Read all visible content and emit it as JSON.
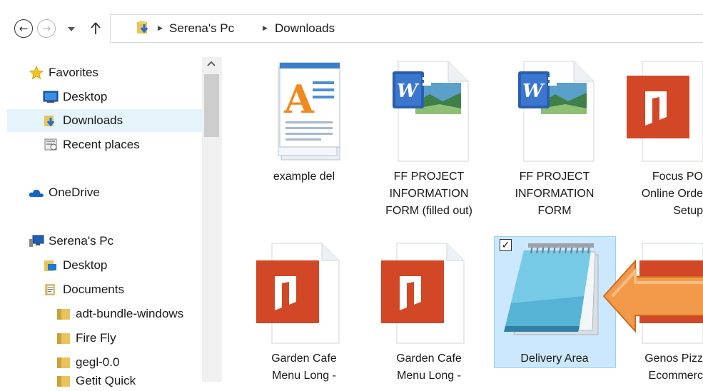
{
  "address_bar": {
    "crumbs": [
      "Serena's Pc",
      "Downloads"
    ]
  },
  "nav": {
    "favorites_label": "Favorites",
    "favorites": [
      "Desktop",
      "Downloads",
      "Recent places"
    ],
    "onedrive_label": "OneDrive",
    "pc_label": "Serena's Pc",
    "pc_items": [
      "Desktop",
      "Documents"
    ],
    "doc_subfolders": [
      "adt-bundle-windows",
      "Fire Fly",
      "gegl-0.0",
      "Getit Quick"
    ],
    "selected_item": "Downloads"
  },
  "files": {
    "row1": [
      {
        "lines": [
          "example del"
        ],
        "type": "wordpad"
      },
      {
        "lines": [
          "FF PROJECT",
          "INFORMATION",
          "FORM (filled out)"
        ],
        "type": "word"
      },
      {
        "lines": [
          "FF PROJECT",
          "INFORMATION",
          "FORM"
        ],
        "type": "word"
      },
      {
        "lines": [
          "Focus PO",
          "Online Orde",
          "Setup"
        ],
        "type": "pdf"
      }
    ],
    "row2": [
      {
        "lines": [
          "Garden Cafe",
          "Menu Long -"
        ],
        "type": "pdf"
      },
      {
        "lines": [
          "Garden Cafe",
          "Menu Long -"
        ],
        "type": "pdf"
      },
      {
        "lines": [
          "Delivery Area"
        ],
        "type": "notepad",
        "selected": true
      },
      {
        "lines": [
          "Genos Pizz",
          "Ecommerc"
        ],
        "type": "pdf"
      }
    ]
  },
  "colors": {
    "selection_bg": "#cce8ff",
    "nav_selected_bg": "#e5f3fb",
    "pdf_red": "#d24726",
    "annotation_arrow": "#f39a4a"
  }
}
